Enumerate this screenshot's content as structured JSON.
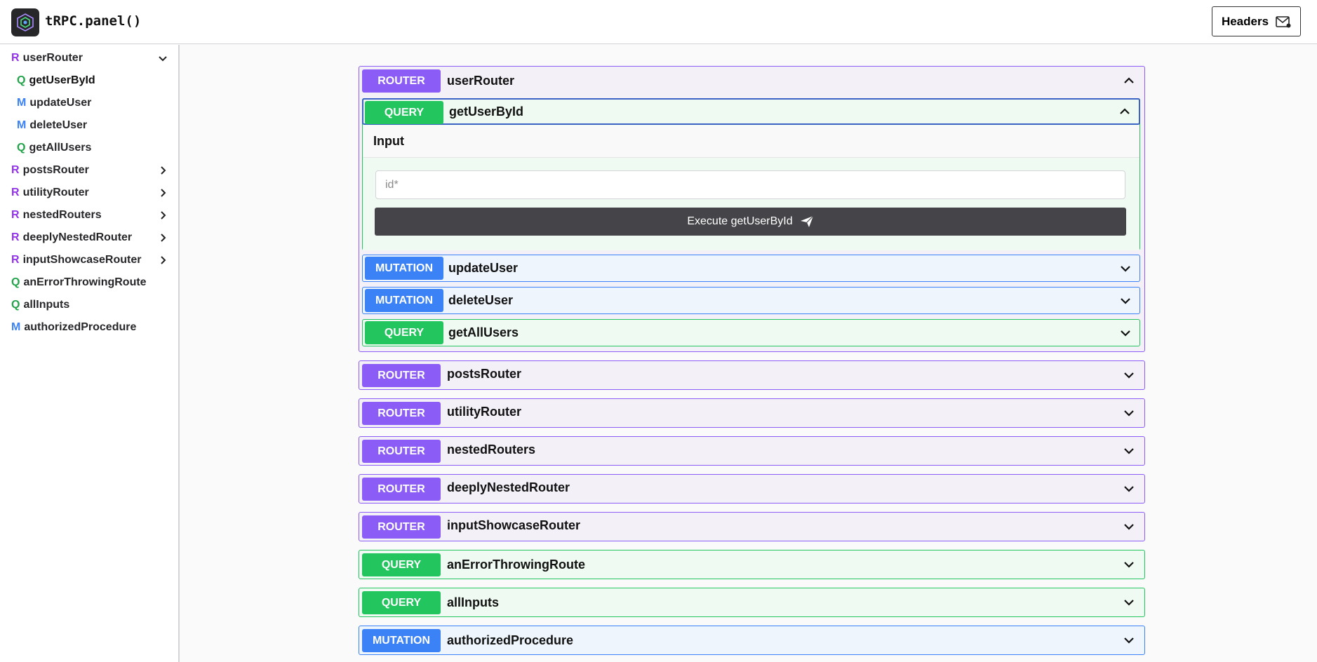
{
  "app": {
    "title": "tRPC.panel()",
    "headers_label": "Headers"
  },
  "sidebar": {
    "items": [
      {
        "letter": "R",
        "label": "userRouter",
        "kind": "R",
        "expanded": true
      },
      {
        "letter": "Q",
        "label": "getUserById",
        "kind": "Q",
        "selected": true
      },
      {
        "letter": "M",
        "label": "updateUser",
        "kind": "M"
      },
      {
        "letter": "M",
        "label": "deleteUser",
        "kind": "M"
      },
      {
        "letter": "Q",
        "label": "getAllUsers",
        "kind": "Q"
      },
      {
        "letter": "R",
        "label": "postsRouter",
        "kind": "R"
      },
      {
        "letter": "R",
        "label": "utilityRouter",
        "kind": "R"
      },
      {
        "letter": "R",
        "label": "nestedRouters",
        "kind": "R"
      },
      {
        "letter": "R",
        "label": "deeplyNestedRouter",
        "kind": "R"
      },
      {
        "letter": "R",
        "label": "inputShowcaseRouter",
        "kind": "R"
      },
      {
        "letter": "Q",
        "label": "anErrorThrowingRoute",
        "kind": "Q"
      },
      {
        "letter": "Q",
        "label": "allInputs",
        "kind": "Q"
      },
      {
        "letter": "M",
        "label": "authorizedProcedure",
        "kind": "M"
      }
    ]
  },
  "badges": {
    "router": "ROUTER",
    "query": "QUERY",
    "mutation": "MUTATION"
  },
  "main": {
    "user_router": {
      "name": "userRouter",
      "children": [
        {
          "badge": "QUERY",
          "name": "getUserById",
          "expanded": true
        },
        {
          "badge": "MUTATION",
          "name": "updateUser"
        },
        {
          "badge": "MUTATION",
          "name": "deleteUser"
        },
        {
          "badge": "QUERY",
          "name": "getAllUsers"
        }
      ]
    },
    "procedure_input": {
      "section_label": "Input",
      "id_placeholder": "id*",
      "id_value": "",
      "execute_label": "Execute getUserById"
    },
    "top_level": [
      {
        "badge": "ROUTER",
        "name": "postsRouter"
      },
      {
        "badge": "ROUTER",
        "name": "utilityRouter"
      },
      {
        "badge": "ROUTER",
        "name": "nestedRouters"
      },
      {
        "badge": "ROUTER",
        "name": "deeplyNestedRouter"
      },
      {
        "badge": "ROUTER",
        "name": "inputShowcaseRouter"
      },
      {
        "badge": "QUERY",
        "name": "anErrorThrowingRoute"
      },
      {
        "badge": "QUERY",
        "name": "allInputs"
      },
      {
        "badge": "MUTATION",
        "name": "authorizedProcedure"
      }
    ]
  },
  "colors": {
    "router": "#8b5cf6",
    "query": "#22c55e",
    "mutation": "#3b82f6",
    "execute_button": "#444449"
  }
}
